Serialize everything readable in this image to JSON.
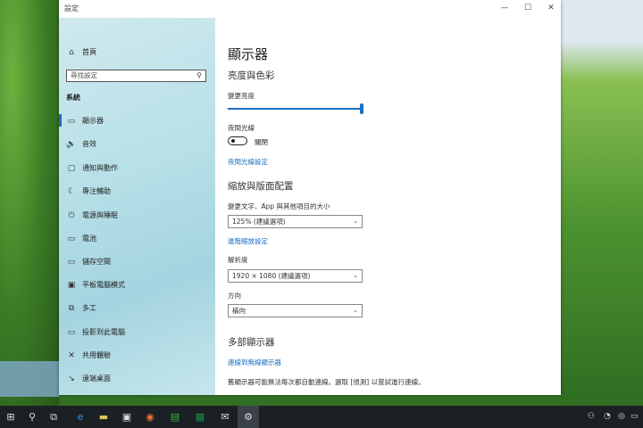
{
  "window": {
    "title": "設定",
    "controls": {
      "minimize": "—",
      "maximize": "☐",
      "close": "✕"
    }
  },
  "sidebar": {
    "home": "首頁",
    "search_placeholder": "尋找設定",
    "section": "系統",
    "items": [
      {
        "label": "顯示器",
        "icon": "▭"
      },
      {
        "label": "音效",
        "icon": "🔈"
      },
      {
        "label": "通知與動作",
        "icon": "▢"
      },
      {
        "label": "專注輔助",
        "icon": "☾"
      },
      {
        "label": "電源與睡眠",
        "icon": "⏻"
      },
      {
        "label": "電池",
        "icon": "▭"
      },
      {
        "label": "儲存空間",
        "icon": "▭"
      },
      {
        "label": "平板電腦模式",
        "icon": "▣"
      },
      {
        "label": "多工",
        "icon": "⧉"
      },
      {
        "label": "投影到此電腦",
        "icon": "▭"
      },
      {
        "label": "共用體驗",
        "icon": "✕"
      },
      {
        "label": "遠端桌面",
        "icon": "↘"
      }
    ]
  },
  "main": {
    "title": "顯示器",
    "brightness_section": "亮度與色彩",
    "brightness_label": "變更亮度",
    "brightness_value": 100,
    "night_light_label": "夜間光線",
    "night_light_state": "關閉",
    "night_light_settings_link": "夜間光線設定",
    "scale_section": "縮放與版面配置",
    "scale_label": "變更文字、App 與其他項目的大小",
    "scale_value": "125% (建議選項)",
    "advanced_scale_link": "進階縮放設定",
    "resolution_label": "解析度",
    "resolution_value": "1920 × 1080 (建議選項)",
    "orientation_label": "方向",
    "orientation_value": "橫向",
    "multi_display_section": "多部顯示器",
    "wireless_link": "連線到無線顯示器",
    "multi_display_note": "舊顯示器可能無法每次都自動連線。選取 [偵測] 以嘗試進行連線。"
  },
  "taskbar": {
    "start": "⊞",
    "search": "⚲",
    "taskview": "⧉",
    "apps": [
      {
        "name": "edge",
        "glyph": "e"
      },
      {
        "name": "file-explorer",
        "glyph": "▬"
      },
      {
        "name": "store",
        "glyph": "▣"
      },
      {
        "name": "firefox",
        "glyph": "◉"
      },
      {
        "name": "green-app",
        "glyph": "▤"
      },
      {
        "name": "excel",
        "glyph": "▦"
      },
      {
        "name": "mail",
        "glyph": "✉"
      },
      {
        "name": "settings",
        "glyph": "⚙"
      }
    ],
    "tray": {
      "people": "⚇",
      "wifi": "◔",
      "power": "◎",
      "chat": "▭"
    }
  },
  "colors": {
    "accent": "#1a6fbf",
    "taskbar": "#1b2024"
  }
}
